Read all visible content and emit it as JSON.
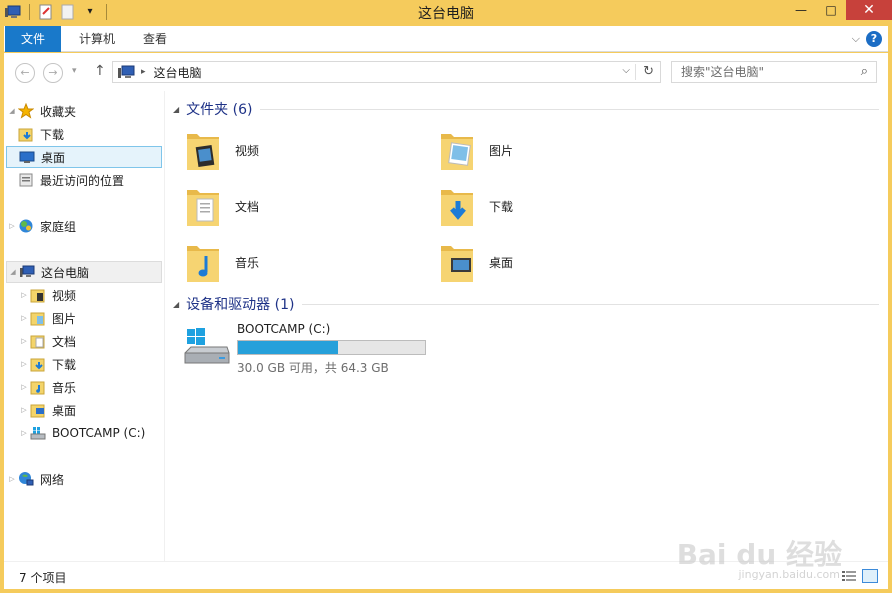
{
  "window": {
    "title": "这台电脑",
    "qat_dropdown": "▾",
    "controls": {
      "minimize": "—",
      "maximize": "□",
      "close": "✕"
    }
  },
  "ribbon": {
    "tabs": [
      "文件",
      "计算机",
      "查看"
    ],
    "expand_icon": "chevron-down-icon",
    "help_label": "?"
  },
  "address": {
    "back": "←",
    "forward": "→",
    "recent": "▾",
    "up": "↑",
    "breadcrumb_sep": "▸",
    "current": "这台电脑",
    "dropdown": "⌵",
    "refresh": "↻",
    "search_placeholder": "搜索\"这台电脑\"",
    "search_icon": "⌕"
  },
  "nav": {
    "favorites": {
      "label": "收藏夹",
      "items": [
        "下载",
        "桌面",
        "最近访问的位置"
      ]
    },
    "homegroup": "家庭组",
    "thispc": {
      "label": "这台电脑",
      "items": [
        "视频",
        "图片",
        "文档",
        "下载",
        "音乐",
        "桌面",
        "BOOTCAMP (C:)"
      ]
    },
    "network": "网络"
  },
  "main": {
    "folders_group": "文件夹 (6)",
    "folders": [
      "视频",
      "图片",
      "文档",
      "下载",
      "音乐",
      "桌面"
    ],
    "devices_group": "设备和驱动器 (1)",
    "drive": {
      "name": "BOOTCAMP (C:)",
      "used_fraction": 0.534,
      "info": "30.0 GB 可用，共 64.3 GB"
    }
  },
  "status": {
    "count": "7 个项目"
  },
  "watermark": {
    "logo": "Bai du 经验",
    "url": "jingyan.baidu.com"
  },
  "colors": {
    "titlebar": "#f5cb5c",
    "file_tab": "#1979ca",
    "selection": "#e5f3fb",
    "progress": "#26a0da",
    "group_title": "#1e3287"
  }
}
